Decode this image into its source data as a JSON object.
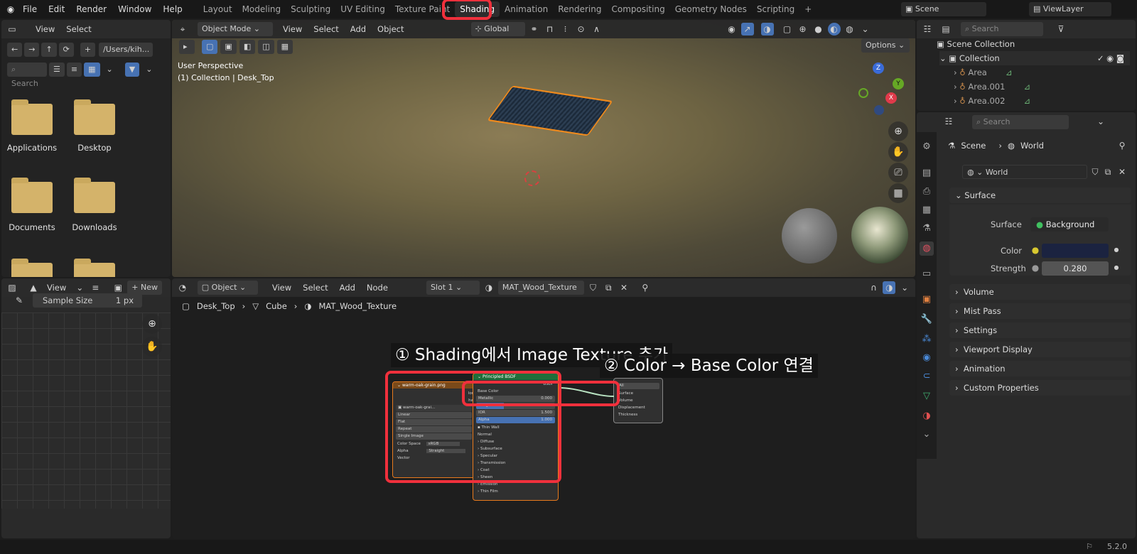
{
  "menu": {
    "items": [
      "File",
      "Edit",
      "Render",
      "Window",
      "Help"
    ]
  },
  "workspaces": [
    "Layout",
    "Modeling",
    "Sculpting",
    "UV Editing",
    "Texture Paint",
    "Shading",
    "Animation",
    "Rendering",
    "Compositing",
    "Geometry Nodes",
    "Scripting"
  ],
  "active_workspace": "Shading",
  "add_tab": "+",
  "scene": {
    "name": "Scene",
    "viewlayer": "ViewLayer"
  },
  "filebrowser": {
    "menu_view": "View",
    "menu_select": "Select",
    "path": "/Users/kih...",
    "search_placeholder": "Search",
    "folders": [
      "Applications",
      "Desktop",
      "Documents",
      "Downloads"
    ]
  },
  "viewport": {
    "mode": "Object Mode",
    "menus": [
      "View",
      "Select",
      "Add",
      "Object"
    ],
    "transform": "Global",
    "options": "Options",
    "info_line1": "User Perspective",
    "info_line2": "(1) Collection | Desk_Top",
    "gizmo": {
      "z": "Z",
      "y": "Y",
      "x": "X"
    }
  },
  "image_editor": {
    "view": "View",
    "new": "New",
    "sample_label": "Sample Size",
    "sample_value": "1 px"
  },
  "node_editor": {
    "mode": "Object",
    "menus": [
      "View",
      "Select",
      "Add",
      "Node"
    ],
    "slot": "Slot 1",
    "material": "MAT_Wood_Texture",
    "breadcrumb": [
      "Desk_Top",
      "Cube",
      "MAT_Wood_Texture"
    ],
    "image_node": {
      "title": "warm-oak-grain.png",
      "file": "warm-oak-grai...",
      "rows": [
        "Linear",
        "Flat",
        "Repeat",
        "Single Image"
      ],
      "cs_label": "Color Space",
      "cs_value": "sRGB",
      "alpha_label": "Alpha",
      "alpha_value": "Straight",
      "vector": "Vector",
      "color": "lor",
      "alpha": "ha"
    },
    "bsdf_node": {
      "title": "Principled BSDF",
      "out": "BSDF",
      "base_color": "Base Color",
      "metallic": "Metallic",
      "metallic_val": "0.000",
      "roughness": "Roughness",
      "roughness_val": "0.350",
      "ior": "IOR",
      "ior_val": "1.500",
      "alpha": "Alpha",
      "alpha_val": "1.000",
      "thin_wall": "Thin Wall",
      "normal": "Normal",
      "sub": [
        "Diffuse",
        "Subsurface",
        "Specular",
        "Transmission",
        "Coat",
        "Sheen",
        "Emission",
        "Thin Film"
      ]
    },
    "output_node": {
      "all": "All",
      "rows": [
        "Surface",
        "Volume",
        "Displacement",
        "Thickness"
      ]
    },
    "annotation1": "① Shading에서 Image Texture 추가",
    "annotation2": "② Color → Base Color 연결"
  },
  "outliner": {
    "search_placeholder": "Search",
    "scene_collection": "Scene Collection",
    "collection": "Collection",
    "items": [
      "Area",
      "Area.001",
      "Area.002"
    ]
  },
  "properties": {
    "search_placeholder": "Search",
    "breadcrumb_scene": "Scene",
    "breadcrumb_world": "World",
    "world": "World",
    "surface_panel": "Surface",
    "surface_label": "Surface",
    "surface_value": "Background",
    "color_label": "Color",
    "color_value": "#1b2340",
    "strength_label": "Strength",
    "strength_value": "0.280",
    "panels": [
      "Volume",
      "Mist Pass",
      "Settings",
      "Viewport Display",
      "Animation",
      "Custom Properties"
    ]
  },
  "status": {
    "version": "5.2.0"
  }
}
